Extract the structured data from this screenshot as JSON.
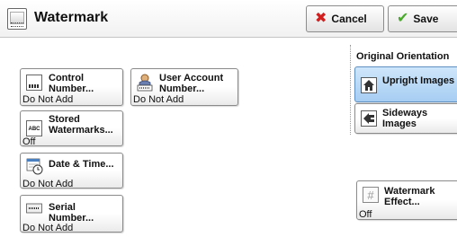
{
  "header": {
    "title": "Watermark",
    "cancel_label": "Cancel",
    "save_label": "Save"
  },
  "buttons": {
    "control_number": {
      "label_line1": "Control",
      "label_line2": "Number...",
      "value": "Do Not Add"
    },
    "user_account_number": {
      "label_line1": "User Account",
      "label_line2": "Number...",
      "value": "Do Not Add"
    },
    "stored_watermarks": {
      "label_line1": "Stored",
      "label_line2": "Watermarks...",
      "value": "Off"
    },
    "date_time": {
      "label": "Date & Time...",
      "value": "Do Not Add"
    },
    "serial_number": {
      "label": "Serial Number...",
      "value": "Do Not Add"
    },
    "watermark_effect": {
      "label_line1": "Watermark",
      "label_line2": "Effect...",
      "value": "Off"
    }
  },
  "orientation": {
    "title": "Original Orientation",
    "upright": "Upright Images",
    "sideways_line1": "Sideways",
    "sideways_line2": "Images",
    "selected": "upright"
  },
  "icons": {
    "title": "watermark-icon",
    "cancel": "cancel-x-icon",
    "save": "save-check-icon",
    "control_number": "counter-icon",
    "user_account": "user-icon",
    "stored_watermarks": "abc-doc-icon",
    "date_time": "calendar-clock-icon",
    "serial_number": "serial-icon",
    "watermark_effect": "hash-doc-icon",
    "upright": "upright-house-icon",
    "sideways": "sideways-house-icon"
  },
  "colors": {
    "selected_bg": "#a6cdf2",
    "cancel_icon": "#d11e1e",
    "save_icon": "#4aa82c"
  }
}
